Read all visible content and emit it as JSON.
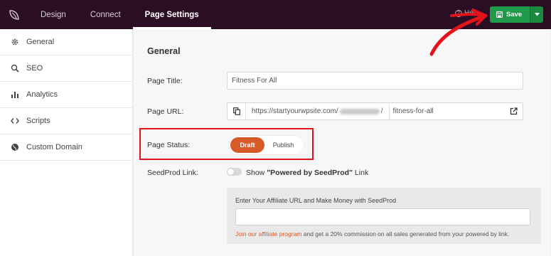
{
  "topbar": {
    "tabs": [
      {
        "label": "Design",
        "active": false
      },
      {
        "label": "Connect",
        "active": false
      },
      {
        "label": "Page Settings",
        "active": true
      }
    ],
    "help_label": "Hel",
    "save_label": "Save",
    "background": "#2b0e23",
    "save_color": "#1f9a48"
  },
  "sidebar": {
    "items": [
      {
        "label": "General",
        "icon": "gear-icon"
      },
      {
        "label": "SEO",
        "icon": "search-icon"
      },
      {
        "label": "Analytics",
        "icon": "bar-chart-icon"
      },
      {
        "label": "Scripts",
        "icon": "code-icon"
      },
      {
        "label": "Custom Domain",
        "icon": "globe-icon"
      }
    ]
  },
  "main": {
    "section_title": "General",
    "page_title": {
      "label": "Page Title:",
      "value": "Fitness For All"
    },
    "page_url": {
      "label": "Page URL:",
      "base": "https://startyourwpsite.com/",
      "slash": "/",
      "slug": "fitness-for-all"
    },
    "page_status": {
      "label": "Page Status:",
      "options": [
        "Draft",
        "Publish"
      ],
      "selected": "Draft",
      "accent": "#d85a29"
    },
    "seedprod_link": {
      "label": "SeedProd Link:",
      "text_prefix": "Show ",
      "text_bold": "\"Powered by SeedProd\"",
      "text_suffix": " Link",
      "enabled": false
    },
    "affiliate": {
      "prompt": "Enter Your Affiliate URL and Make Money with SeedProd",
      "url_value": "",
      "link_text": "Join our affiliate program",
      "rest_text": " and get a 20% commission on all sales generated from your powered by link."
    }
  }
}
